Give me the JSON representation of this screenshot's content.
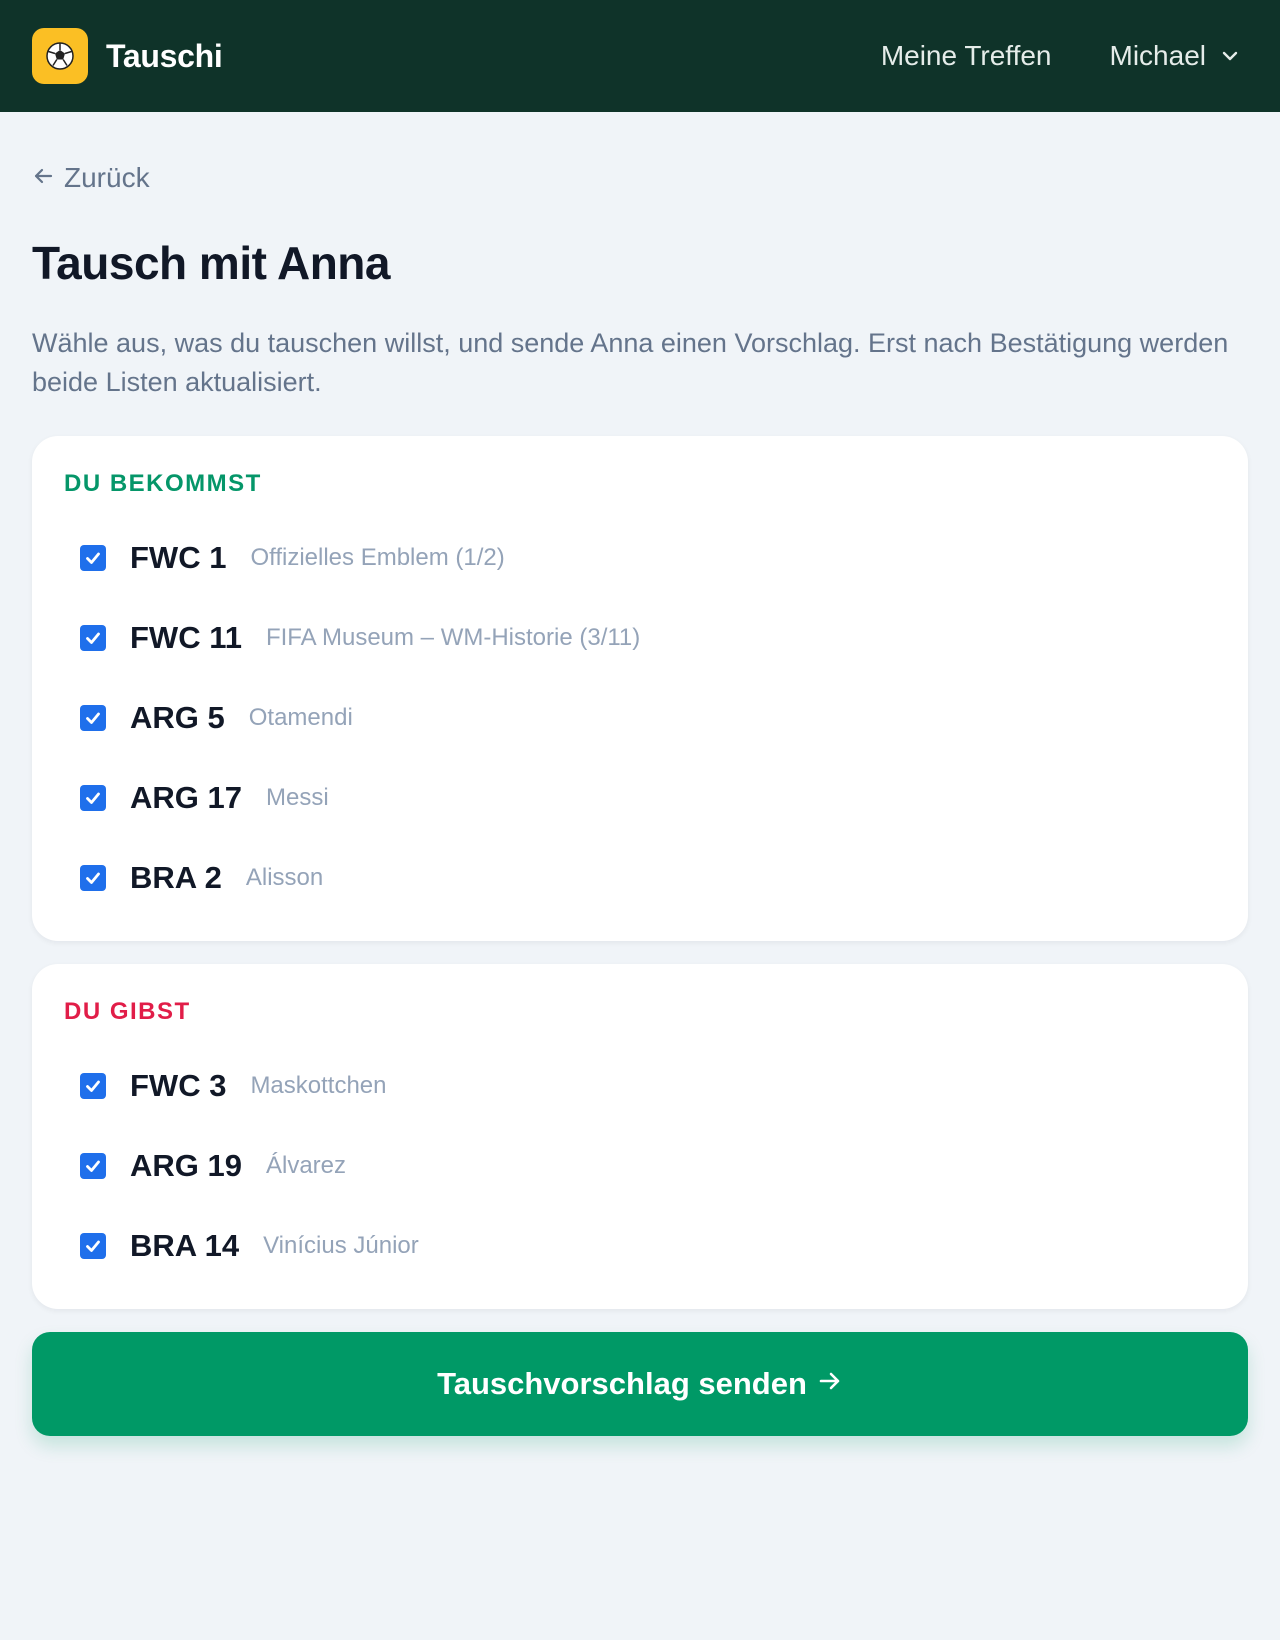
{
  "header": {
    "app_name": "Tauschi",
    "logo_icon": "soccer-ball-icon",
    "nav_meetings": "Meine Treffen",
    "user_name": "Michael"
  },
  "page": {
    "back_label": "Zurück",
    "title": "Tausch mit Anna",
    "description": "Wähle aus, was du tauschen willst, und sende Anna einen Vorschlag. Erst nach Bestätigung werden beide Listen aktualisiert."
  },
  "receive": {
    "heading": "DU BEKOMMST",
    "items": [
      {
        "code": "FWC 1",
        "name": "Offizielles Emblem (1/2)",
        "checked": true
      },
      {
        "code": "FWC 11",
        "name": "FIFA Museum – WM-Historie (3/11)",
        "checked": true
      },
      {
        "code": "ARG 5",
        "name": "Otamendi",
        "checked": true
      },
      {
        "code": "ARG 17",
        "name": "Messi",
        "checked": true
      },
      {
        "code": "BRA 2",
        "name": "Alisson",
        "checked": true
      }
    ]
  },
  "give": {
    "heading": "DU GIBST",
    "items": [
      {
        "code": "FWC 3",
        "name": "Maskottchen",
        "checked": true
      },
      {
        "code": "ARG 19",
        "name": "Álvarez",
        "checked": true
      },
      {
        "code": "BRA 14",
        "name": "Vinícius Júnior",
        "checked": true
      }
    ]
  },
  "actions": {
    "submit_label": "Tauschvorschlag senden"
  },
  "colors": {
    "header_bg": "#0f3329",
    "logo_bg": "#fbbf24",
    "receive_accent": "#059669",
    "give_accent": "#e11d48",
    "checkbox": "#1f6feb",
    "button_bg": "#009966"
  }
}
